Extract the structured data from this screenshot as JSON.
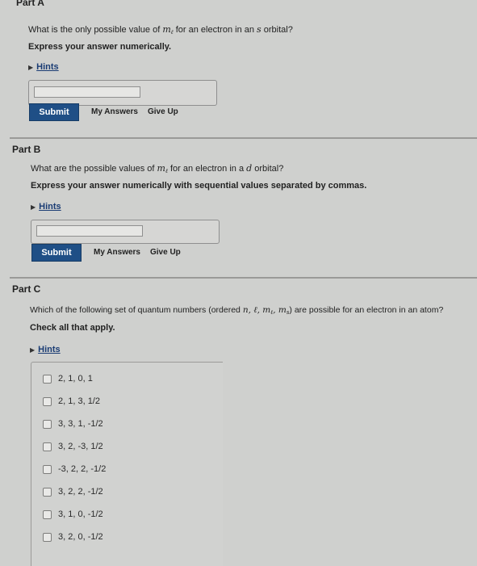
{
  "partA": {
    "title": "Part A",
    "question_pre": "What is the only possible value of",
    "var_main": "m",
    "var_sub": "ℓ",
    "question_post": "for an electron in an",
    "orbital_letter": "s",
    "question_end": "orbital?",
    "instruction": "Express your answer numerically.",
    "hints": "Hints",
    "answer_value": "",
    "submit": "Submit",
    "my_answers": "My Answers",
    "give_up": "Give Up"
  },
  "partB": {
    "title": "Part B",
    "question_pre": "What are the possible values of",
    "var_main": "m",
    "var_sub": "ℓ",
    "question_post": "for an electron in a",
    "orbital_letter": "d",
    "question_end": "orbital?",
    "instruction": "Express your answer numerically with sequential values separated by commas.",
    "hints": "Hints",
    "answer_value": "",
    "submit": "Submit",
    "my_answers": "My Answers",
    "give_up": "Give Up"
  },
  "partC": {
    "title": "Part C",
    "question_pre": "Which of the following set of quantum numbers (ordered",
    "ordered_vars": "n, ℓ, m",
    "ordered_sub_l": "ℓ",
    "ordered_ms": ", m",
    "ordered_sub_s": "s",
    "question_post": ") are possible for an electron in an atom?",
    "instruction": "Check all that apply.",
    "hints": "Hints",
    "options": [
      "2, 1, 0, 1",
      "2, 1, 3, 1/2",
      "3, 3, 1, -1/2",
      "3, 2, -3, 1/2",
      "-3, 2, 2, -1/2",
      "3, 2, 2, -1/2",
      "3, 1, 0, -1/2",
      "3, 2, 0, -1/2"
    ]
  }
}
